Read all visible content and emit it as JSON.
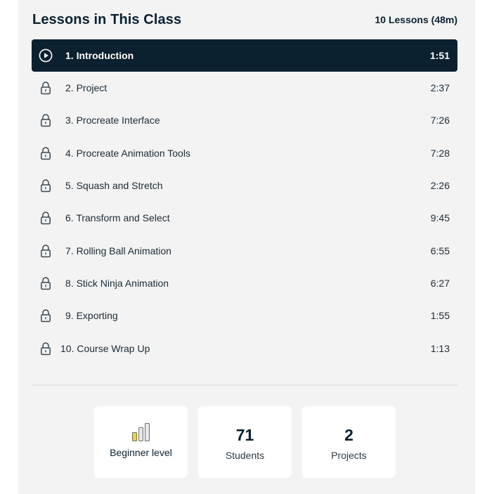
{
  "header": {
    "title": "Lessons in This Class",
    "summary": "10 Lessons (48m)"
  },
  "lessons": [
    {
      "label": "1. Introduction",
      "duration": "1:51",
      "icon": "play-icon",
      "active": true
    },
    {
      "label": "2. Project",
      "duration": "2:37",
      "icon": "lock-icon"
    },
    {
      "label": "3. Procreate Interface",
      "duration": "7:26",
      "icon": "lock-icon"
    },
    {
      "label": "4. Procreate Animation Tools",
      "duration": "7:28",
      "icon": "lock-icon"
    },
    {
      "label": "5. Squash and Stretch",
      "duration": "2:26",
      "icon": "lock-icon"
    },
    {
      "label": "6. Transform and Select",
      "duration": "9:45",
      "icon": "lock-icon"
    },
    {
      "label": "7. Rolling Ball Animation",
      "duration": "6:55",
      "icon": "lock-icon"
    },
    {
      "label": "8. Stick Ninja Animation",
      "duration": "6:27",
      "icon": "lock-icon"
    },
    {
      "label": "9. Exporting",
      "duration": "1:55",
      "icon": "lock-icon"
    },
    {
      "label": "10. Course Wrap Up",
      "duration": "1:13",
      "icon": "lock-icon"
    }
  ],
  "stats": {
    "level": {
      "label": "Beginner level",
      "filled_bars": 1,
      "total_bars": 3,
      "fill_color": "#f2d12e"
    },
    "students": {
      "value": "71",
      "label": "Students"
    },
    "projects": {
      "value": "2",
      "label": "Projects"
    }
  },
  "colors": {
    "active_bg": "#0b2130",
    "panel_bg": "#f3f3f3"
  }
}
